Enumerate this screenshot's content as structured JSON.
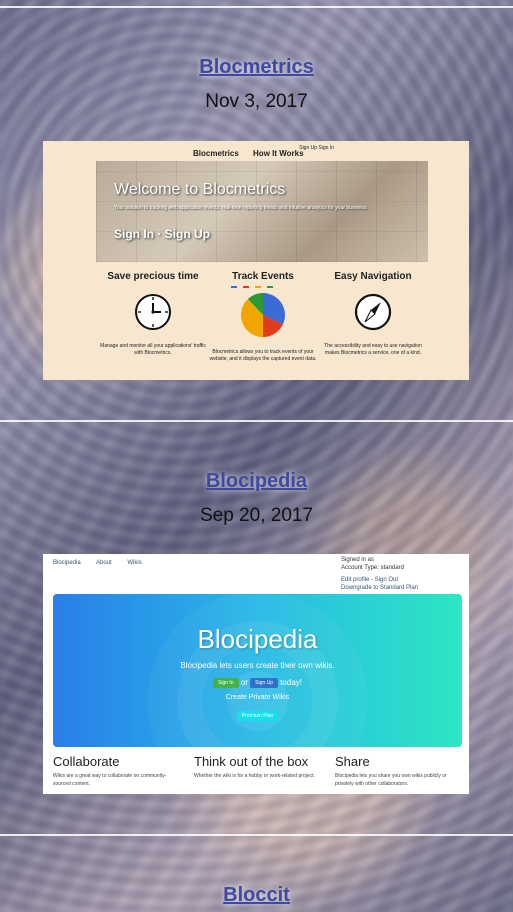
{
  "projects": [
    {
      "title": "Blocmetrics",
      "date": "Nov 3, 2017"
    },
    {
      "title": "Blocipedia",
      "date": "Sep 20, 2017"
    },
    {
      "title": "Bloccit"
    }
  ],
  "blocmetrics": {
    "nav": [
      "Blocmetrics",
      "How It Works"
    ],
    "auth": [
      "Sign Up",
      "Sign In"
    ],
    "hero_title": "Welcome to Blocmetrics",
    "hero_sub": "Your solution to tracking web application events, real-time reporting trends and intuitive analytics for your business.",
    "hero_cta": "Sign In · Sign Up",
    "columns": [
      {
        "heading": "Save precious time",
        "text": "Manage and monitor all your applications' traffic with Blocmetrics."
      },
      {
        "heading": "Track Events",
        "text": "Blocmetrics allows you to track events of your website, and it displays the captured event data."
      },
      {
        "heading": "Easy Navigation",
        "text": "The accessibility and easy to use navigation makes Blocmetrics a service, one of a kind."
      }
    ],
    "pie_slices": [
      0.32,
      0.18,
      0.38,
      0.12
    ]
  },
  "blocipedia": {
    "nav": [
      "Blocipedia",
      "About",
      "Wikis"
    ],
    "user": {
      "signed_in": "Signed in as",
      "account_type": "Account Type: standard",
      "edit": "Edit profile - Sign Out",
      "downgrade": "Downgrade to Standard Plan"
    },
    "hero_title": "Blocipedia",
    "hero_sub": "Blocipedia lets users create their own wikis.",
    "sign_in": "Sign In",
    "or": "or",
    "sign_up": "Sign Up",
    "today": "today!",
    "create_private": "Create Private Wikis",
    "premium": "Premium Plan",
    "features": [
      {
        "heading": "Collaborate",
        "text": "Wikis are a great way to collaborate on community-sourced content."
      },
      {
        "heading": "Think out of the box",
        "text": "Whether the wiki is for a hobby or work-related project."
      },
      {
        "heading": "Share",
        "text": "Blocipedia lets you share you own wikis publicly or privately with other collaborators."
      }
    ]
  }
}
